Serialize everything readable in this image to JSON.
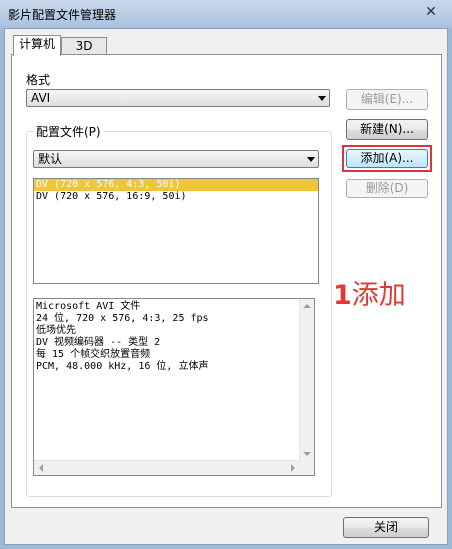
{
  "window": {
    "title": "影片配置文件管理器",
    "close_glyph": "✕"
  },
  "tabs": [
    {
      "label": "计算机",
      "active": true
    },
    {
      "label": "3D",
      "active": false
    }
  ],
  "format": {
    "label": "格式",
    "selected": "AVI"
  },
  "profile_group": {
    "label": "配置文件(P)",
    "selected": "默认"
  },
  "profiles": [
    {
      "text": "DV (720 x 576, 4:3, 50i)",
      "selected": true
    },
    {
      "text": "DV (720 x 576, 16:9, 50i)",
      "selected": false
    }
  ],
  "description_lines": [
    "Microsoft AVI 文件",
    "24 位, 720 x 576, 4:3, 25 fps",
    "低场优先",
    "DV 视频编码器 -- 类型 2",
    "每 15 个帧交织放置音频",
    "PCM, 48.000 kHz, 16 位, 立体声"
  ],
  "buttons": {
    "edit": "编辑(E)...",
    "new": "新建(N)...",
    "add": "添加(A)...",
    "delete": "删除(D)",
    "close": "关闭"
  },
  "annotation": {
    "number": "1",
    "text": "添加"
  },
  "colors": {
    "accent_red": "#d9353b",
    "selection": "#f0c53c"
  }
}
